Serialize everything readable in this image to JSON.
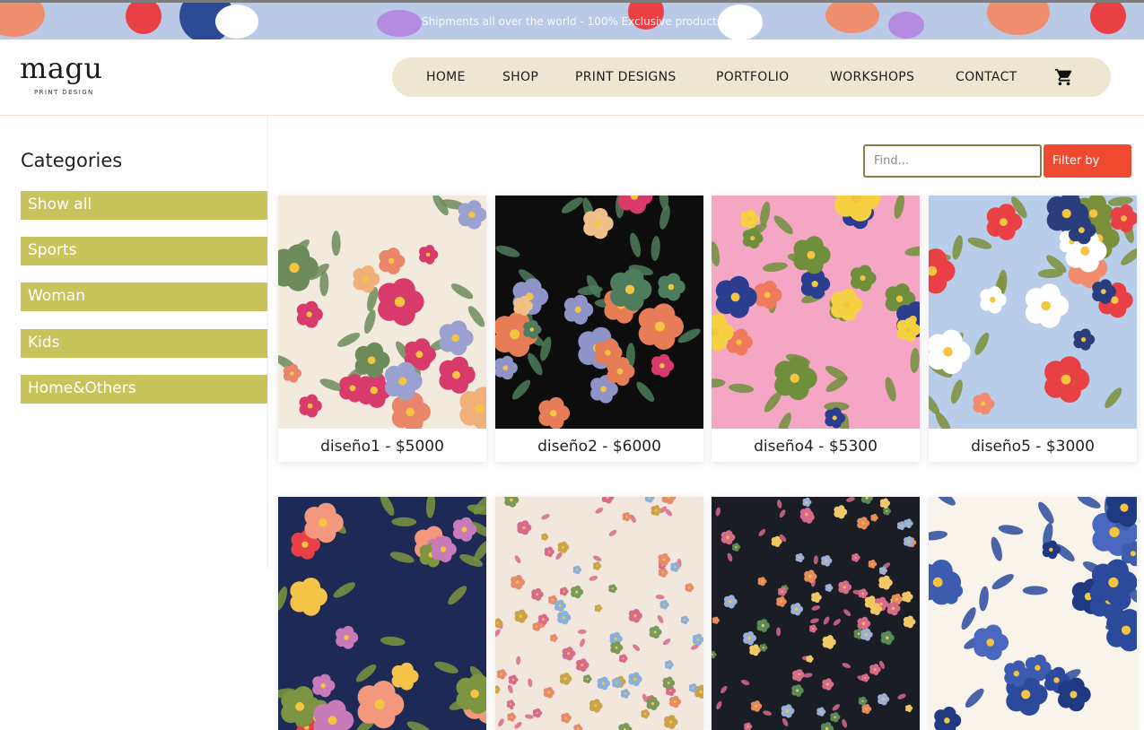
{
  "announcement": {
    "text": "Shipments all over the world - 100% Exclusive products"
  },
  "brand": {
    "name": "magu",
    "tagline": "PRINT DESIGN"
  },
  "nav": {
    "items": [
      "HOME",
      "SHOP",
      "PRINT DESIGNS",
      "PORTFOLIO",
      "WORKSHOPS",
      "CONTACT"
    ],
    "cart_icon": "shopping-cart-icon"
  },
  "sidebar": {
    "title": "Categories",
    "items": [
      "Show all",
      "Sports",
      "Woman",
      "Kids",
      "Home&Others"
    ],
    "item_color": "#c8c35a"
  },
  "search": {
    "placeholder": "Find...",
    "filter_label": "Filter by",
    "filter_color": "#ef4a2f"
  },
  "products": [
    {
      "caption": "diseño1 - $5000",
      "pattern": "cream-pink-floral",
      "bg": "#f2ebdd"
    },
    {
      "caption": "diseño2 - $6000",
      "pattern": "black-pink-floral",
      "bg": "#0d0d0d"
    },
    {
      "caption": "diseño4 - $5300",
      "pattern": "pink-peach-floral",
      "bg": "#f4a6c4"
    },
    {
      "caption": "diseño5 - $3000",
      "pattern": "blue-peach-floral",
      "bg": "#b7cdea"
    },
    {
      "caption": "",
      "pattern": "navy-peach-floral",
      "bg": "#1c2a55"
    },
    {
      "caption": "",
      "pattern": "cream-ditsy-floral",
      "bg": "#f1e7dd"
    },
    {
      "caption": "",
      "pattern": "dark-ditsy-floral",
      "bg": "#1b1d25"
    },
    {
      "caption": "",
      "pattern": "white-blue-floral",
      "bg": "#f8f4ec"
    }
  ]
}
